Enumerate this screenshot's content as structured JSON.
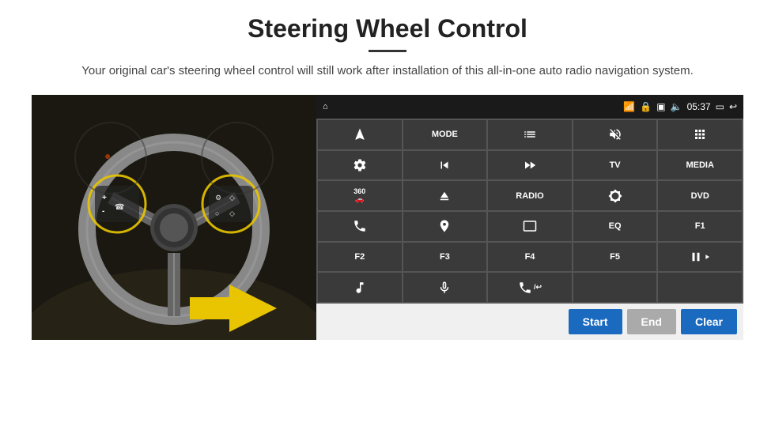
{
  "header": {
    "title": "Steering Wheel Control",
    "subtitle": "Your original car's steering wheel control will still work after installation of this all-in-one auto radio navigation system."
  },
  "status_bar": {
    "time": "05:37",
    "home_icon": "⌂"
  },
  "control_buttons": [
    {
      "id": "btn-nav",
      "icon": "arrow",
      "label": ""
    },
    {
      "id": "btn-mode",
      "icon": "",
      "label": "MODE"
    },
    {
      "id": "btn-list",
      "icon": "list",
      "label": ""
    },
    {
      "id": "btn-mute",
      "icon": "mute",
      "label": ""
    },
    {
      "id": "btn-menu",
      "icon": "menu",
      "label": ""
    },
    {
      "id": "btn-settings",
      "icon": "gear",
      "label": ""
    },
    {
      "id": "btn-prev",
      "icon": "prev",
      "label": ""
    },
    {
      "id": "btn-next",
      "icon": "next",
      "label": ""
    },
    {
      "id": "btn-tv",
      "icon": "",
      "label": "TV"
    },
    {
      "id": "btn-media",
      "icon": "",
      "label": "MEDIA"
    },
    {
      "id": "btn-360",
      "icon": "360",
      "label": ""
    },
    {
      "id": "btn-eject",
      "icon": "eject",
      "label": ""
    },
    {
      "id": "btn-radio",
      "icon": "",
      "label": "RADIO"
    },
    {
      "id": "btn-bright",
      "icon": "bright",
      "label": ""
    },
    {
      "id": "btn-dvd",
      "icon": "",
      "label": "DVD"
    },
    {
      "id": "btn-phone",
      "icon": "phone",
      "label": ""
    },
    {
      "id": "btn-navi",
      "icon": "navi",
      "label": ""
    },
    {
      "id": "btn-rect",
      "icon": "rect",
      "label": ""
    },
    {
      "id": "btn-eq",
      "icon": "",
      "label": "EQ"
    },
    {
      "id": "btn-f1",
      "icon": "",
      "label": "F1"
    },
    {
      "id": "btn-f2",
      "icon": "",
      "label": "F2"
    },
    {
      "id": "btn-f3",
      "icon": "",
      "label": "F3"
    },
    {
      "id": "btn-f4",
      "icon": "",
      "label": "F4"
    },
    {
      "id": "btn-f5",
      "icon": "",
      "label": "F5"
    },
    {
      "id": "btn-playpause",
      "icon": "playpause",
      "label": ""
    },
    {
      "id": "btn-music",
      "icon": "music",
      "label": ""
    },
    {
      "id": "btn-mic",
      "icon": "mic",
      "label": ""
    },
    {
      "id": "btn-call",
      "icon": "call",
      "label": ""
    },
    {
      "id": "btn-empty1",
      "icon": "",
      "label": ""
    },
    {
      "id": "btn-empty2",
      "icon": "",
      "label": ""
    }
  ],
  "bottom_bar": {
    "start_label": "Start",
    "end_label": "End",
    "clear_label": "Clear"
  }
}
